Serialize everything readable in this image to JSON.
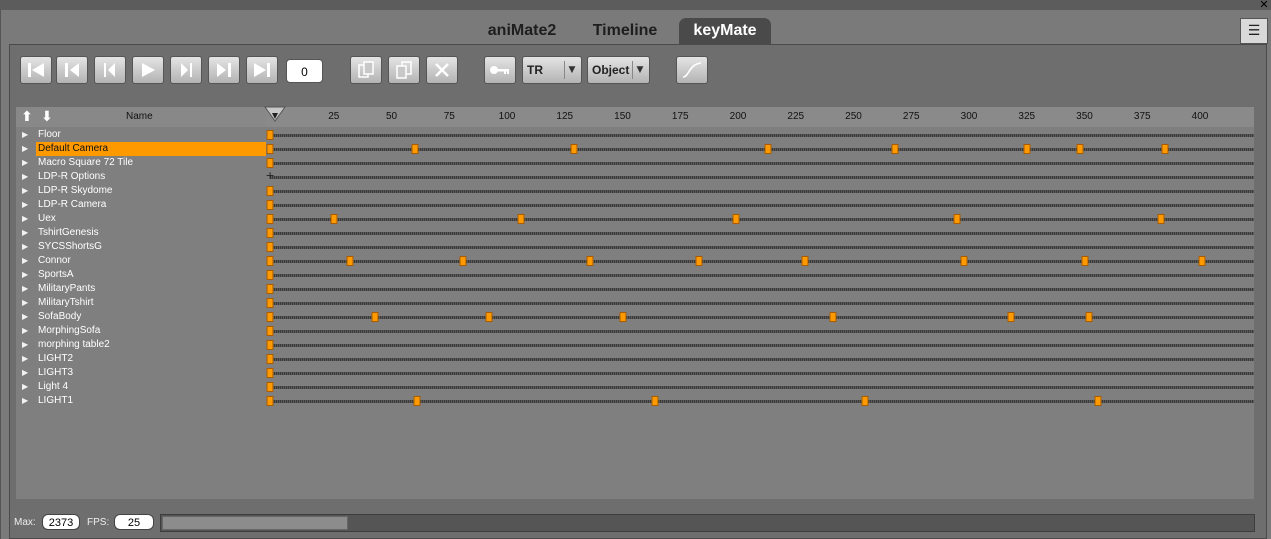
{
  "window": {
    "close_glyph": "✕"
  },
  "tabs": [
    {
      "label": "aniMate2",
      "active": false
    },
    {
      "label": "Timeline",
      "active": false
    },
    {
      "label": "keyMate",
      "active": true
    }
  ],
  "toolbar": {
    "transport": [
      "go-to-start",
      "previous-key",
      "previous-frame",
      "play",
      "next-frame",
      "next-key",
      "go-to-end"
    ],
    "current_frame": "0",
    "edit": [
      "copy-key",
      "paste-key",
      "delete-key"
    ],
    "key_icon": "key-icon",
    "channel_select": "TR",
    "scope_select": "Object",
    "curve_icon": "curve-editor-icon"
  },
  "timeline": {
    "name_header": "Name",
    "ruler_ticks": [
      "25",
      "50",
      "75",
      "100",
      "125",
      "150",
      "175",
      "200",
      "225",
      "250",
      "275",
      "300",
      "325",
      "350",
      "375",
      "400"
    ],
    "frame_range": [
      0,
      400
    ],
    "rows": [
      {
        "name": "Floor",
        "selected": false,
        "keys": [
          0
        ]
      },
      {
        "name": "Default Camera",
        "selected": true,
        "keys": [
          0,
          60,
          129,
          213,
          268,
          325,
          348,
          385
        ]
      },
      {
        "name": "Macro Square 72 Tile",
        "selected": false,
        "keys": [
          0
        ]
      },
      {
        "name": "LDP-R Options",
        "selected": false,
        "keys": [],
        "cross": [
          0
        ]
      },
      {
        "name": "LDP-R Skydome",
        "selected": false,
        "keys": [
          0
        ]
      },
      {
        "name": "LDP-R Camera",
        "selected": false,
        "keys": [
          0
        ]
      },
      {
        "name": "Uex",
        "selected": false,
        "keys": [
          0,
          25,
          106,
          199,
          295,
          383
        ]
      },
      {
        "name": "TshirtGenesis",
        "selected": false,
        "keys": [
          0
        ]
      },
      {
        "name": "SYCSShortsG",
        "selected": false,
        "keys": [
          0
        ]
      },
      {
        "name": "Connor",
        "selected": false,
        "keys": [
          0,
          32,
          81,
          136,
          183,
          229,
          298,
          350,
          401
        ]
      },
      {
        "name": "SportsA",
        "selected": false,
        "keys": [
          0
        ]
      },
      {
        "name": "MilitaryPants",
        "selected": false,
        "keys": [
          0
        ]
      },
      {
        "name": "MilitaryTshirt",
        "selected": false,
        "keys": [
          0
        ]
      },
      {
        "name": "SofaBody",
        "selected": false,
        "keys": [
          0,
          43,
          92,
          150,
          241,
          318,
          352
        ]
      },
      {
        "name": "MorphingSofa",
        "selected": false,
        "keys": [
          0
        ]
      },
      {
        "name": "morphing table2",
        "selected": false,
        "keys": [
          0
        ]
      },
      {
        "name": "LIGHT2",
        "selected": false,
        "keys": [
          0
        ]
      },
      {
        "name": "LIGHT3",
        "selected": false,
        "keys": [
          0
        ]
      },
      {
        "name": "Light 4",
        "selected": false,
        "keys": [
          0
        ]
      },
      {
        "name": "LIGHT1",
        "selected": false,
        "keys": [
          0,
          61,
          164,
          255,
          356
        ]
      }
    ]
  },
  "footer": {
    "max_label": "Max:",
    "max_value": "2373",
    "fps_label": "FPS:",
    "fps_value": "25",
    "scroll_fraction": 0.17
  },
  "colors": {
    "accent": "#ff9900",
    "active_tab": "#4a4a4a"
  }
}
